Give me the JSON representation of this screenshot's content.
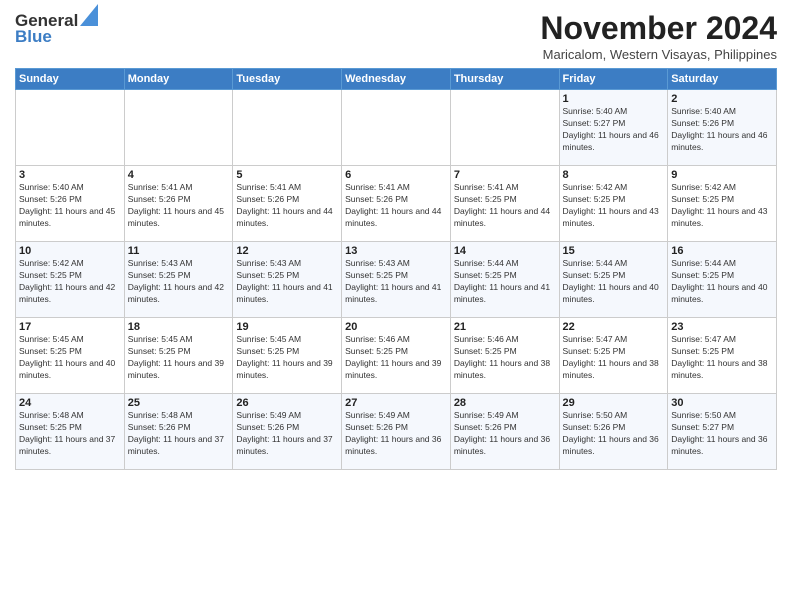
{
  "logo": {
    "line1": "General",
    "line2": "Blue"
  },
  "title": "November 2024",
  "location": "Maricalom, Western Visayas, Philippines",
  "days_of_week": [
    "Sunday",
    "Monday",
    "Tuesday",
    "Wednesday",
    "Thursday",
    "Friday",
    "Saturday"
  ],
  "weeks": [
    [
      {
        "day": "",
        "info": ""
      },
      {
        "day": "",
        "info": ""
      },
      {
        "day": "",
        "info": ""
      },
      {
        "day": "",
        "info": ""
      },
      {
        "day": "",
        "info": ""
      },
      {
        "day": "1",
        "info": "Sunrise: 5:40 AM\nSunset: 5:27 PM\nDaylight: 11 hours and 46 minutes."
      },
      {
        "day": "2",
        "info": "Sunrise: 5:40 AM\nSunset: 5:26 PM\nDaylight: 11 hours and 46 minutes."
      }
    ],
    [
      {
        "day": "3",
        "info": "Sunrise: 5:40 AM\nSunset: 5:26 PM\nDaylight: 11 hours and 45 minutes."
      },
      {
        "day": "4",
        "info": "Sunrise: 5:41 AM\nSunset: 5:26 PM\nDaylight: 11 hours and 45 minutes."
      },
      {
        "day": "5",
        "info": "Sunrise: 5:41 AM\nSunset: 5:26 PM\nDaylight: 11 hours and 44 minutes."
      },
      {
        "day": "6",
        "info": "Sunrise: 5:41 AM\nSunset: 5:26 PM\nDaylight: 11 hours and 44 minutes."
      },
      {
        "day": "7",
        "info": "Sunrise: 5:41 AM\nSunset: 5:25 PM\nDaylight: 11 hours and 44 minutes."
      },
      {
        "day": "8",
        "info": "Sunrise: 5:42 AM\nSunset: 5:25 PM\nDaylight: 11 hours and 43 minutes."
      },
      {
        "day": "9",
        "info": "Sunrise: 5:42 AM\nSunset: 5:25 PM\nDaylight: 11 hours and 43 minutes."
      }
    ],
    [
      {
        "day": "10",
        "info": "Sunrise: 5:42 AM\nSunset: 5:25 PM\nDaylight: 11 hours and 42 minutes."
      },
      {
        "day": "11",
        "info": "Sunrise: 5:43 AM\nSunset: 5:25 PM\nDaylight: 11 hours and 42 minutes."
      },
      {
        "day": "12",
        "info": "Sunrise: 5:43 AM\nSunset: 5:25 PM\nDaylight: 11 hours and 41 minutes."
      },
      {
        "day": "13",
        "info": "Sunrise: 5:43 AM\nSunset: 5:25 PM\nDaylight: 11 hours and 41 minutes."
      },
      {
        "day": "14",
        "info": "Sunrise: 5:44 AM\nSunset: 5:25 PM\nDaylight: 11 hours and 41 minutes."
      },
      {
        "day": "15",
        "info": "Sunrise: 5:44 AM\nSunset: 5:25 PM\nDaylight: 11 hours and 40 minutes."
      },
      {
        "day": "16",
        "info": "Sunrise: 5:44 AM\nSunset: 5:25 PM\nDaylight: 11 hours and 40 minutes."
      }
    ],
    [
      {
        "day": "17",
        "info": "Sunrise: 5:45 AM\nSunset: 5:25 PM\nDaylight: 11 hours and 40 minutes."
      },
      {
        "day": "18",
        "info": "Sunrise: 5:45 AM\nSunset: 5:25 PM\nDaylight: 11 hours and 39 minutes."
      },
      {
        "day": "19",
        "info": "Sunrise: 5:45 AM\nSunset: 5:25 PM\nDaylight: 11 hours and 39 minutes."
      },
      {
        "day": "20",
        "info": "Sunrise: 5:46 AM\nSunset: 5:25 PM\nDaylight: 11 hours and 39 minutes."
      },
      {
        "day": "21",
        "info": "Sunrise: 5:46 AM\nSunset: 5:25 PM\nDaylight: 11 hours and 38 minutes."
      },
      {
        "day": "22",
        "info": "Sunrise: 5:47 AM\nSunset: 5:25 PM\nDaylight: 11 hours and 38 minutes."
      },
      {
        "day": "23",
        "info": "Sunrise: 5:47 AM\nSunset: 5:25 PM\nDaylight: 11 hours and 38 minutes."
      }
    ],
    [
      {
        "day": "24",
        "info": "Sunrise: 5:48 AM\nSunset: 5:25 PM\nDaylight: 11 hours and 37 minutes."
      },
      {
        "day": "25",
        "info": "Sunrise: 5:48 AM\nSunset: 5:26 PM\nDaylight: 11 hours and 37 minutes."
      },
      {
        "day": "26",
        "info": "Sunrise: 5:49 AM\nSunset: 5:26 PM\nDaylight: 11 hours and 37 minutes."
      },
      {
        "day": "27",
        "info": "Sunrise: 5:49 AM\nSunset: 5:26 PM\nDaylight: 11 hours and 36 minutes."
      },
      {
        "day": "28",
        "info": "Sunrise: 5:49 AM\nSunset: 5:26 PM\nDaylight: 11 hours and 36 minutes."
      },
      {
        "day": "29",
        "info": "Sunrise: 5:50 AM\nSunset: 5:26 PM\nDaylight: 11 hours and 36 minutes."
      },
      {
        "day": "30",
        "info": "Sunrise: 5:50 AM\nSunset: 5:27 PM\nDaylight: 11 hours and 36 minutes."
      }
    ]
  ]
}
